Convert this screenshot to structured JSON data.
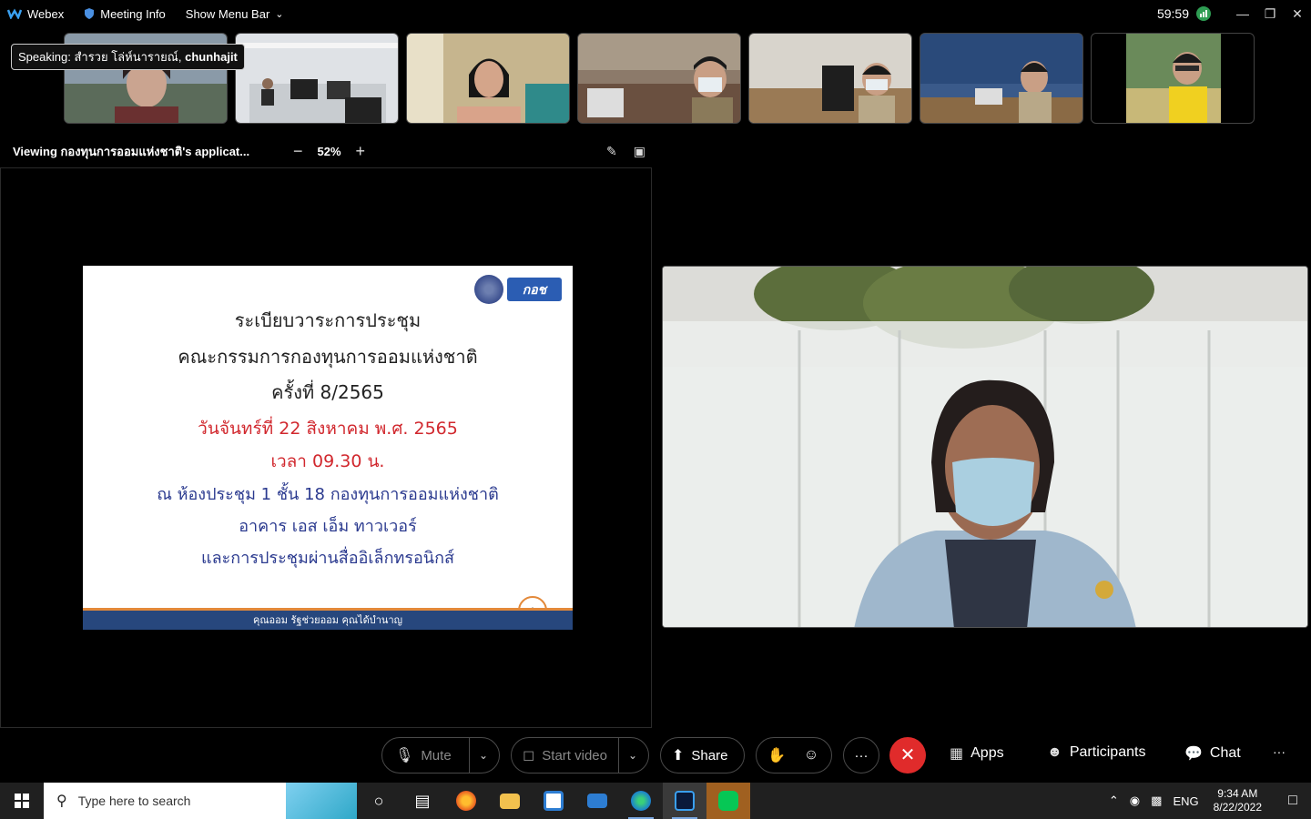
{
  "titlebar": {
    "app_name": "Webex",
    "meeting_info": "Meeting Info",
    "show_menu_bar": "Show Menu Bar",
    "timer": "59:59"
  },
  "speaking": {
    "prefix": "Speaking:",
    "names": "สำรวย โล่ห์นารายณ์,",
    "last": "chunhajit"
  },
  "viewing": {
    "label": "Viewing",
    "name": "กองทุนการออมแห่งชาติ's applicat...",
    "zoom": "52%"
  },
  "slide": {
    "title1": "ระเบียบวาระการประชุม",
    "title2": "คณะกรรมการกองทุนการออมแห่งชาติ",
    "title3": "ครั้งที่ 8/2565",
    "date": "วันจันทร์ที่ 22 สิงหาคม พ.ศ. 2565",
    "time": "เวลา 09.30 น.",
    "place1": "ณ ห้องประชุม 1 ชั้น 18 กองทุนการออมแห่งชาติ",
    "place2": "อาคาร เอส เอ็ม ทาวเวอร์",
    "place3": "และการประชุมผ่านสื่ออิเล็กทรอนิกส์",
    "footer": "คุณออม รัฐช่วยออม คุณได้บำนาญ",
    "page": "1",
    "logo": "กอช"
  },
  "controls": {
    "mute": "Mute",
    "start_video": "Start video",
    "share": "Share",
    "more": "···",
    "apps": "Apps",
    "participants": "Participants",
    "chat": "Chat",
    "overflow": "···"
  },
  "taskbar": {
    "search_placeholder": "Type here to search",
    "language": "ENG",
    "time": "9:34 AM",
    "date": "8/22/2022"
  },
  "colors": {
    "end_call": "#e02b2b",
    "slide_red": "#d1282e",
    "slide_blue": "#2b3a8f",
    "slide_footer": "#27477d"
  }
}
